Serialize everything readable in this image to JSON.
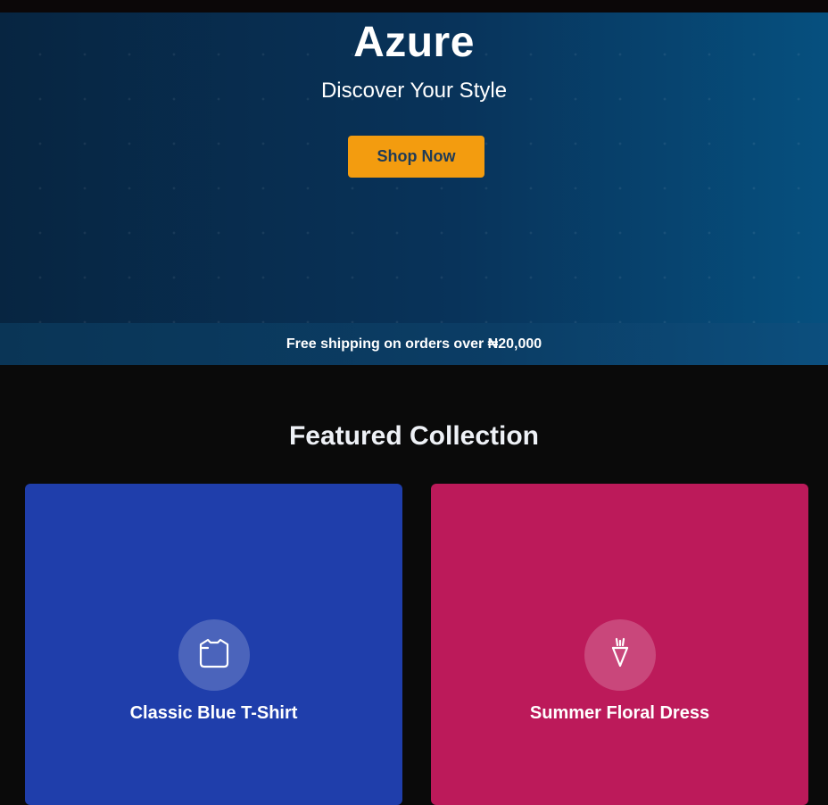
{
  "hero": {
    "title": "Azure",
    "subtitle": "Discover Your Style",
    "cta_label": "Shop Now"
  },
  "shipping_banner": {
    "text": "Free shipping on orders over ₦20,000"
  },
  "featured": {
    "heading": "Featured Collection",
    "products": [
      {
        "name": "Classic Blue T-Shirt",
        "icon": "tshirt-icon",
        "color": "#1f3eab"
      },
      {
        "name": "Summer Floral Dress",
        "icon": "dress-icon",
        "color": "#bc1a5a"
      }
    ]
  },
  "colors": {
    "accent": "#f39c0f",
    "background": "#0a0a0a",
    "hero_start": "#072541",
    "hero_end": "#06507f"
  }
}
